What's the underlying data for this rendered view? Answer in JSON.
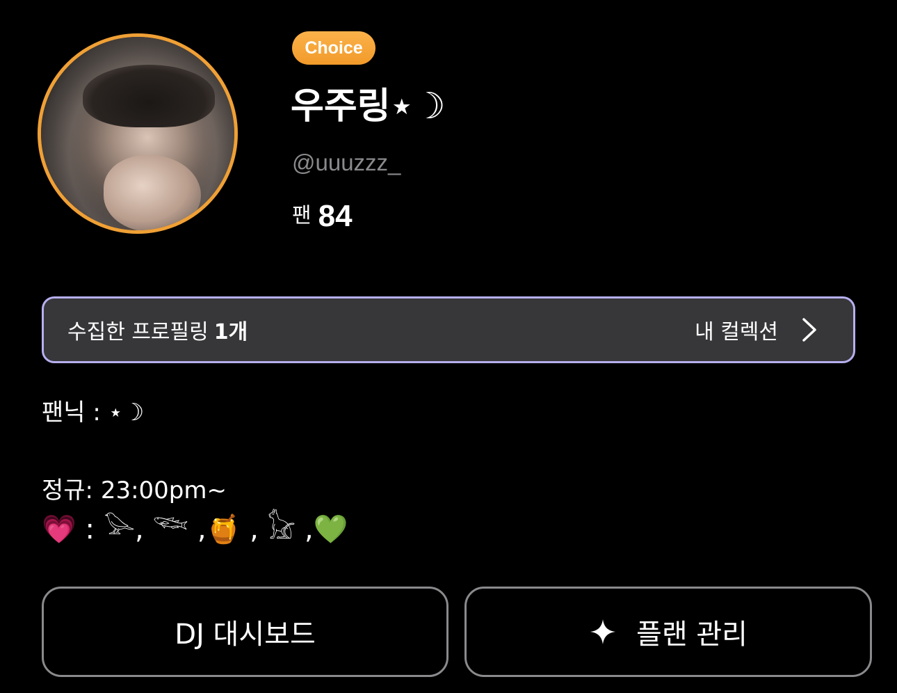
{
  "profile": {
    "badge": "Choice",
    "name": "우주링⋆☽",
    "handle": "@uuuzzz_",
    "fans_label": "팬",
    "fans_count": "84"
  },
  "collection": {
    "label": "수집한 프로필링",
    "count": "1개",
    "link_label": "내 컬렉션"
  },
  "bio": {
    "line1": "팬닉 : ⋆☽",
    "line2": "정규: 23:00pm~",
    "line3": "💗 : 𓅪, 𓆝 ,🍯 , 𓃠 ,💚"
  },
  "buttons": {
    "dj_dashboard": "DJ 대시보드",
    "plan_manage": "플랜 관리"
  },
  "colors": {
    "background": "#000000",
    "badge": "#f29a2a",
    "avatar_ring": "#f0a035",
    "collection_border": "#b6b0f0",
    "collection_bg": "#37373a",
    "handle": "#8a8a8d",
    "button_border": "#8a8a8d"
  },
  "icons": {
    "chevron": "chevron-right-icon",
    "sparkle": "sparkle-icon"
  }
}
